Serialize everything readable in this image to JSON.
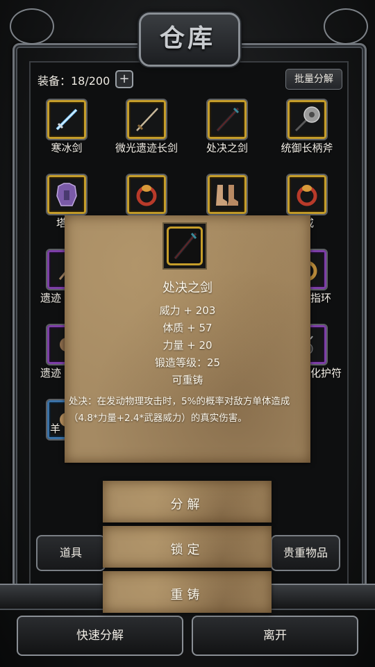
{
  "title": "仓库",
  "header": {
    "equip_label": "装备：18/200",
    "plus_symbol": "+",
    "batch_label": "批量分解"
  },
  "grid": {
    "row1": [
      {
        "name": "寒冰剑",
        "icon": "ice-sword"
      },
      {
        "name": "微光遗迹长剑",
        "icon": "long-sword"
      },
      {
        "name": "处决之剑",
        "icon": "dark-sword"
      },
      {
        "name": "统御长柄斧",
        "icon": "halberd-axe"
      }
    ],
    "row2": [
      {
        "name": "塔拉",
        "icon": "purple-armor"
      },
      {
        "name": "",
        "icon": "ring"
      },
      {
        "name": "",
        "icon": "boots"
      },
      {
        "name": "之戒",
        "icon": "ring"
      }
    ],
    "row3": [
      {
        "name": "遗迹",
        "icon": "purple-item"
      },
      {
        "name": "指环",
        "icon": "ring"
      }
    ],
    "row4": [
      {
        "name": "遗迹",
        "icon": "purple-item"
      },
      {
        "name": "化护符",
        "icon": "amulet"
      }
    ],
    "row5": [
      {
        "name": "羊",
        "icon": "blue-item"
      }
    ]
  },
  "popup": {
    "item_name": "处决之剑",
    "stats": [
      "威力 + 203",
      "体质 + 57",
      "力量 + 20",
      "锻造等级：25",
      "可重铸"
    ],
    "description": "处决：在发动物理攻击时，5%的概率对敌方单体造成（4.8*力量+2.4*武器威力）的真实伤害。"
  },
  "actions": {
    "decompose": "分解",
    "lock": "锁定",
    "reforge": "重铸"
  },
  "tabs": {
    "items": "道具",
    "valuables": "贵重物品"
  },
  "bottom": {
    "quick_decompose": "快速分解",
    "leave": "离开"
  }
}
